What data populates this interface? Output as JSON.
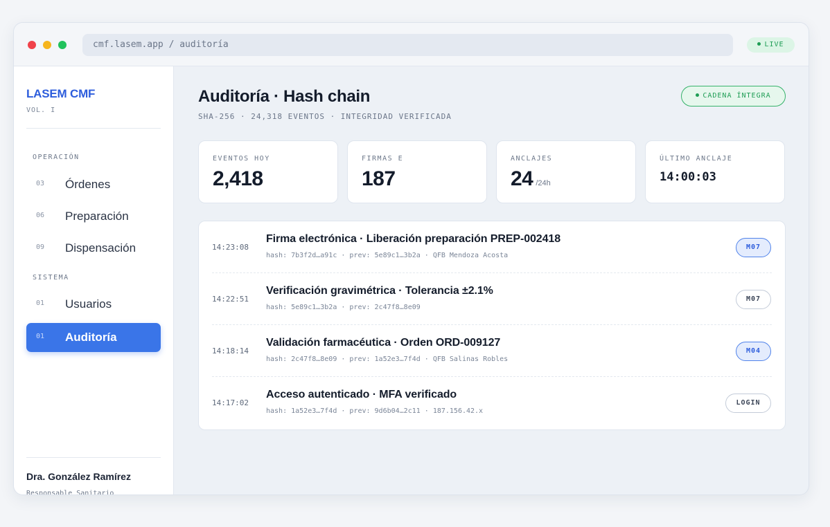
{
  "window": {
    "url": "cmf.lasem.app / auditoría",
    "live_label": "LIVE"
  },
  "sidebar": {
    "brand": "LASEM CMF",
    "volume": "VOL. I",
    "sections": [
      {
        "label": "OPERACIÓN",
        "items": [
          {
            "num": "03",
            "label": "Órdenes",
            "active": false
          },
          {
            "num": "06",
            "label": "Preparación",
            "active": false
          },
          {
            "num": "09",
            "label": "Dispensación",
            "active": false
          }
        ]
      },
      {
        "label": "SISTEMA",
        "items": [
          {
            "num": "01",
            "label": "Usuarios",
            "active": false
          },
          {
            "num": "01",
            "label": "Auditoría",
            "active": true
          }
        ]
      }
    ],
    "user": {
      "name": "Dra. González Ramírez",
      "role": "Responsable Sanitario"
    }
  },
  "header": {
    "title": "Auditoría · Hash chain",
    "subtitle": "SHA-256 · 24,318 EVENTOS · INTEGRIDAD VERIFICADA",
    "integrity_badge": "CADENA ÍNTEGRA"
  },
  "stats": [
    {
      "label": "EVENTOS HOY",
      "value": "2,418",
      "unit": ""
    },
    {
      "label": "FIRMAS E",
      "value": "187",
      "unit": ""
    },
    {
      "label": "ANCLAJES",
      "value": "24",
      "unit": "/24h"
    },
    {
      "label": "ÚLTIMO ANCLAJE",
      "value": "14:00:03",
      "unit": ""
    }
  ],
  "events": [
    {
      "time": "14:23:08",
      "title": "Firma electrónica · Liberación preparación PREP-002418",
      "meta": "hash: 7b3f2d…a91c · prev: 5e89c1…3b2a · QFB Mendoza Acosta",
      "tag": "M07",
      "tag_style": "blue"
    },
    {
      "time": "14:22:51",
      "title": "Verificación gravimétrica · Tolerancia ±2.1%",
      "meta": "hash: 5e89c1…3b2a · prev: 2c47f8…8e09",
      "tag": "M07",
      "tag_style": "neutral"
    },
    {
      "time": "14:18:14",
      "title": "Validación farmacéutica · Orden ORD-009127",
      "meta": "hash: 2c47f8…8e09 · prev: 1a52e3…7f4d · QFB Salinas Robles",
      "tag": "M04",
      "tag_style": "blue"
    },
    {
      "time": "14:17:02",
      "title": "Acceso autenticado · MFA verificado",
      "meta": "hash: 1a52e3…7f4d · prev: 9d6b04…2c11 · 187.156.42.x",
      "tag": "LOGIN",
      "tag_style": "neutral"
    }
  ]
}
